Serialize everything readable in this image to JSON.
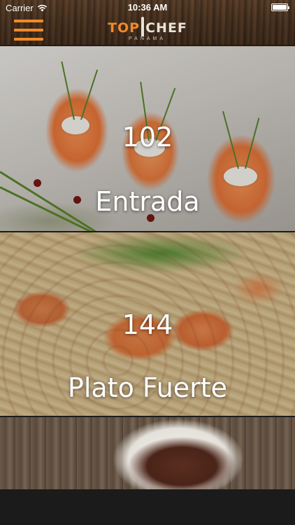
{
  "status_bar": {
    "carrier": "Carrier",
    "time": "10:36 AM"
  },
  "header": {
    "logo_top": "TOP",
    "logo_chef": "CHEF",
    "logo_sub": "PANAMA",
    "menu_icon": "hamburger-menu-icon",
    "accent_color": "#f08a2a"
  },
  "categories": [
    {
      "count": "102",
      "title": "Entrada"
    },
    {
      "count": "144",
      "title": "Plato Fuerte"
    },
    {
      "count": "",
      "title": ""
    }
  ]
}
